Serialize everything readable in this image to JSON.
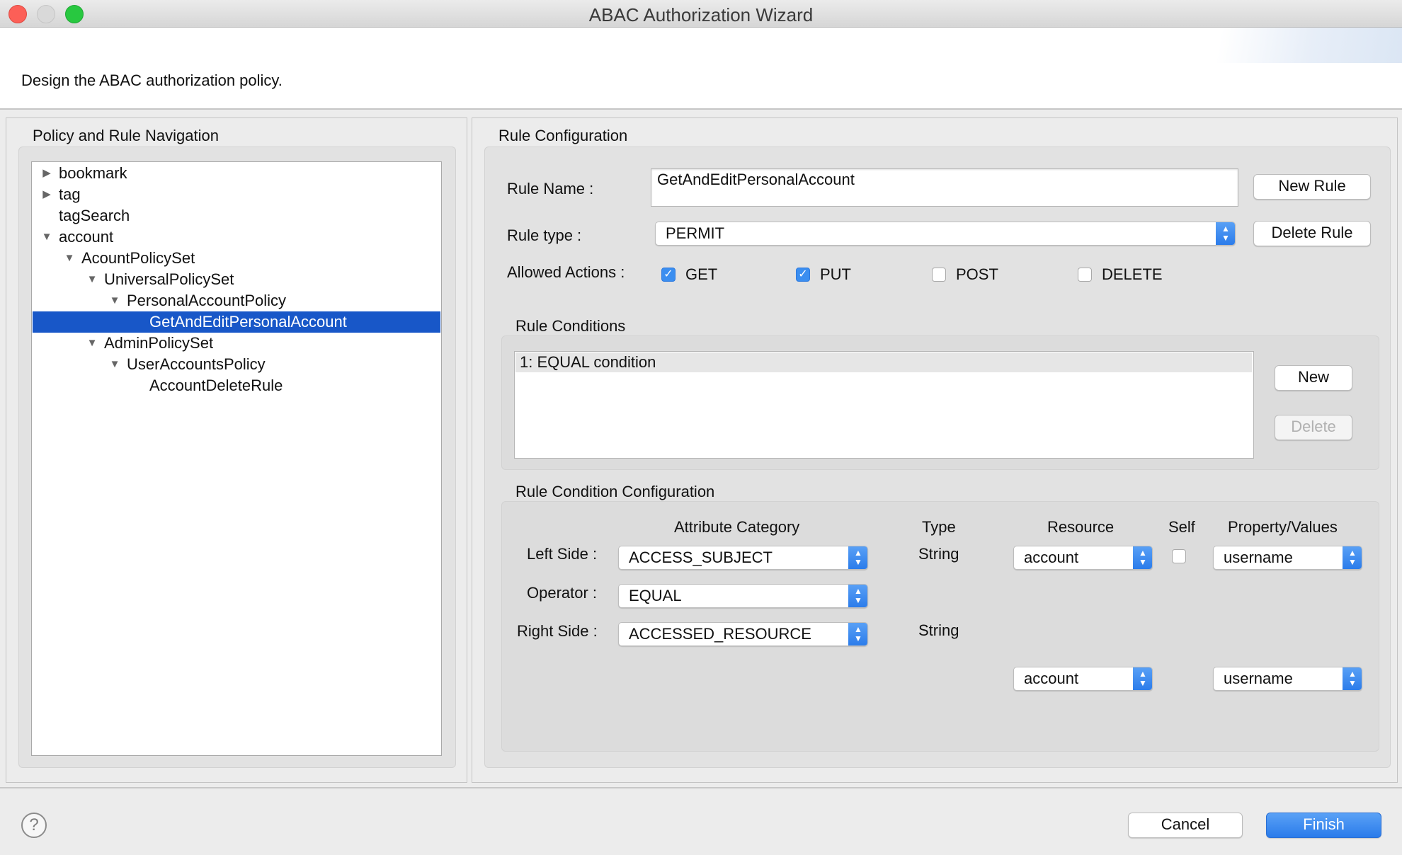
{
  "window": {
    "title": "ABAC Authorization Wizard",
    "description": "Design the ABAC authorization policy."
  },
  "navigation": {
    "title": "Policy and Rule Navigation",
    "tree": [
      {
        "label": "bookmark",
        "level": 0,
        "toggle": "collapsed"
      },
      {
        "label": "tag",
        "level": 0,
        "toggle": "collapsed"
      },
      {
        "label": "tagSearch",
        "level": 0,
        "toggle": "none"
      },
      {
        "label": "account",
        "level": 0,
        "toggle": "expanded"
      },
      {
        "label": "AcountPolicySet",
        "level": 1,
        "toggle": "expanded"
      },
      {
        "label": "UniversalPolicySet",
        "level": 2,
        "toggle": "expanded"
      },
      {
        "label": "PersonalAccountPolicy",
        "level": 3,
        "toggle": "expanded"
      },
      {
        "label": "GetAndEditPersonalAccount",
        "level": 4,
        "toggle": "none",
        "selected": true
      },
      {
        "label": "AdminPolicySet",
        "level": 2,
        "toggle": "expanded"
      },
      {
        "label": "UserAccountsPolicy",
        "level": 3,
        "toggle": "expanded"
      },
      {
        "label": "AccountDeleteRule",
        "level": 4,
        "toggle": "none"
      }
    ]
  },
  "rule": {
    "section_title": "Rule Configuration",
    "name_label": "Rule Name :",
    "name_value": "GetAndEditPersonalAccount",
    "type_label": "Rule type :",
    "type_value": "PERMIT",
    "actions_label": "Allowed Actions :",
    "actions": [
      {
        "label": "GET",
        "checked": true
      },
      {
        "label": "PUT",
        "checked": true
      },
      {
        "label": "POST",
        "checked": false
      },
      {
        "label": "DELETE",
        "checked": false
      }
    ],
    "new_rule_button": "New Rule",
    "delete_rule_button": "Delete Rule"
  },
  "conditions": {
    "section_title": "Rule Conditions",
    "items": [
      "1: EQUAL condition"
    ],
    "new_button": "New",
    "delete_button": "Delete"
  },
  "condition_config": {
    "section_title": "Rule Condition Configuration",
    "headers": {
      "attribute_category": "Attribute Category",
      "type": "Type",
      "resource": "Resource",
      "self": "Self",
      "property_values": "Property/Values"
    },
    "left_side_label": "Left Side :",
    "operator_label": "Operator :",
    "right_side_label": "Right Side :",
    "left_category": "ACCESS_SUBJECT",
    "operator": "EQUAL",
    "right_category": "ACCESSED_RESOURCE",
    "left_type": "String",
    "right_type": "String",
    "left_resource": "account",
    "left_self_checked": false,
    "left_property": "username",
    "right_resource": "account",
    "right_property": "username"
  },
  "footer": {
    "help_glyph": "?",
    "cancel_button": "Cancel",
    "finish_button": "Finish"
  },
  "colors": {
    "selection": "#1857c8",
    "accent_blue": "#2a7bea",
    "close": "#fc5f57",
    "minimize": "#d9d9d9",
    "zoom": "#28c840"
  }
}
